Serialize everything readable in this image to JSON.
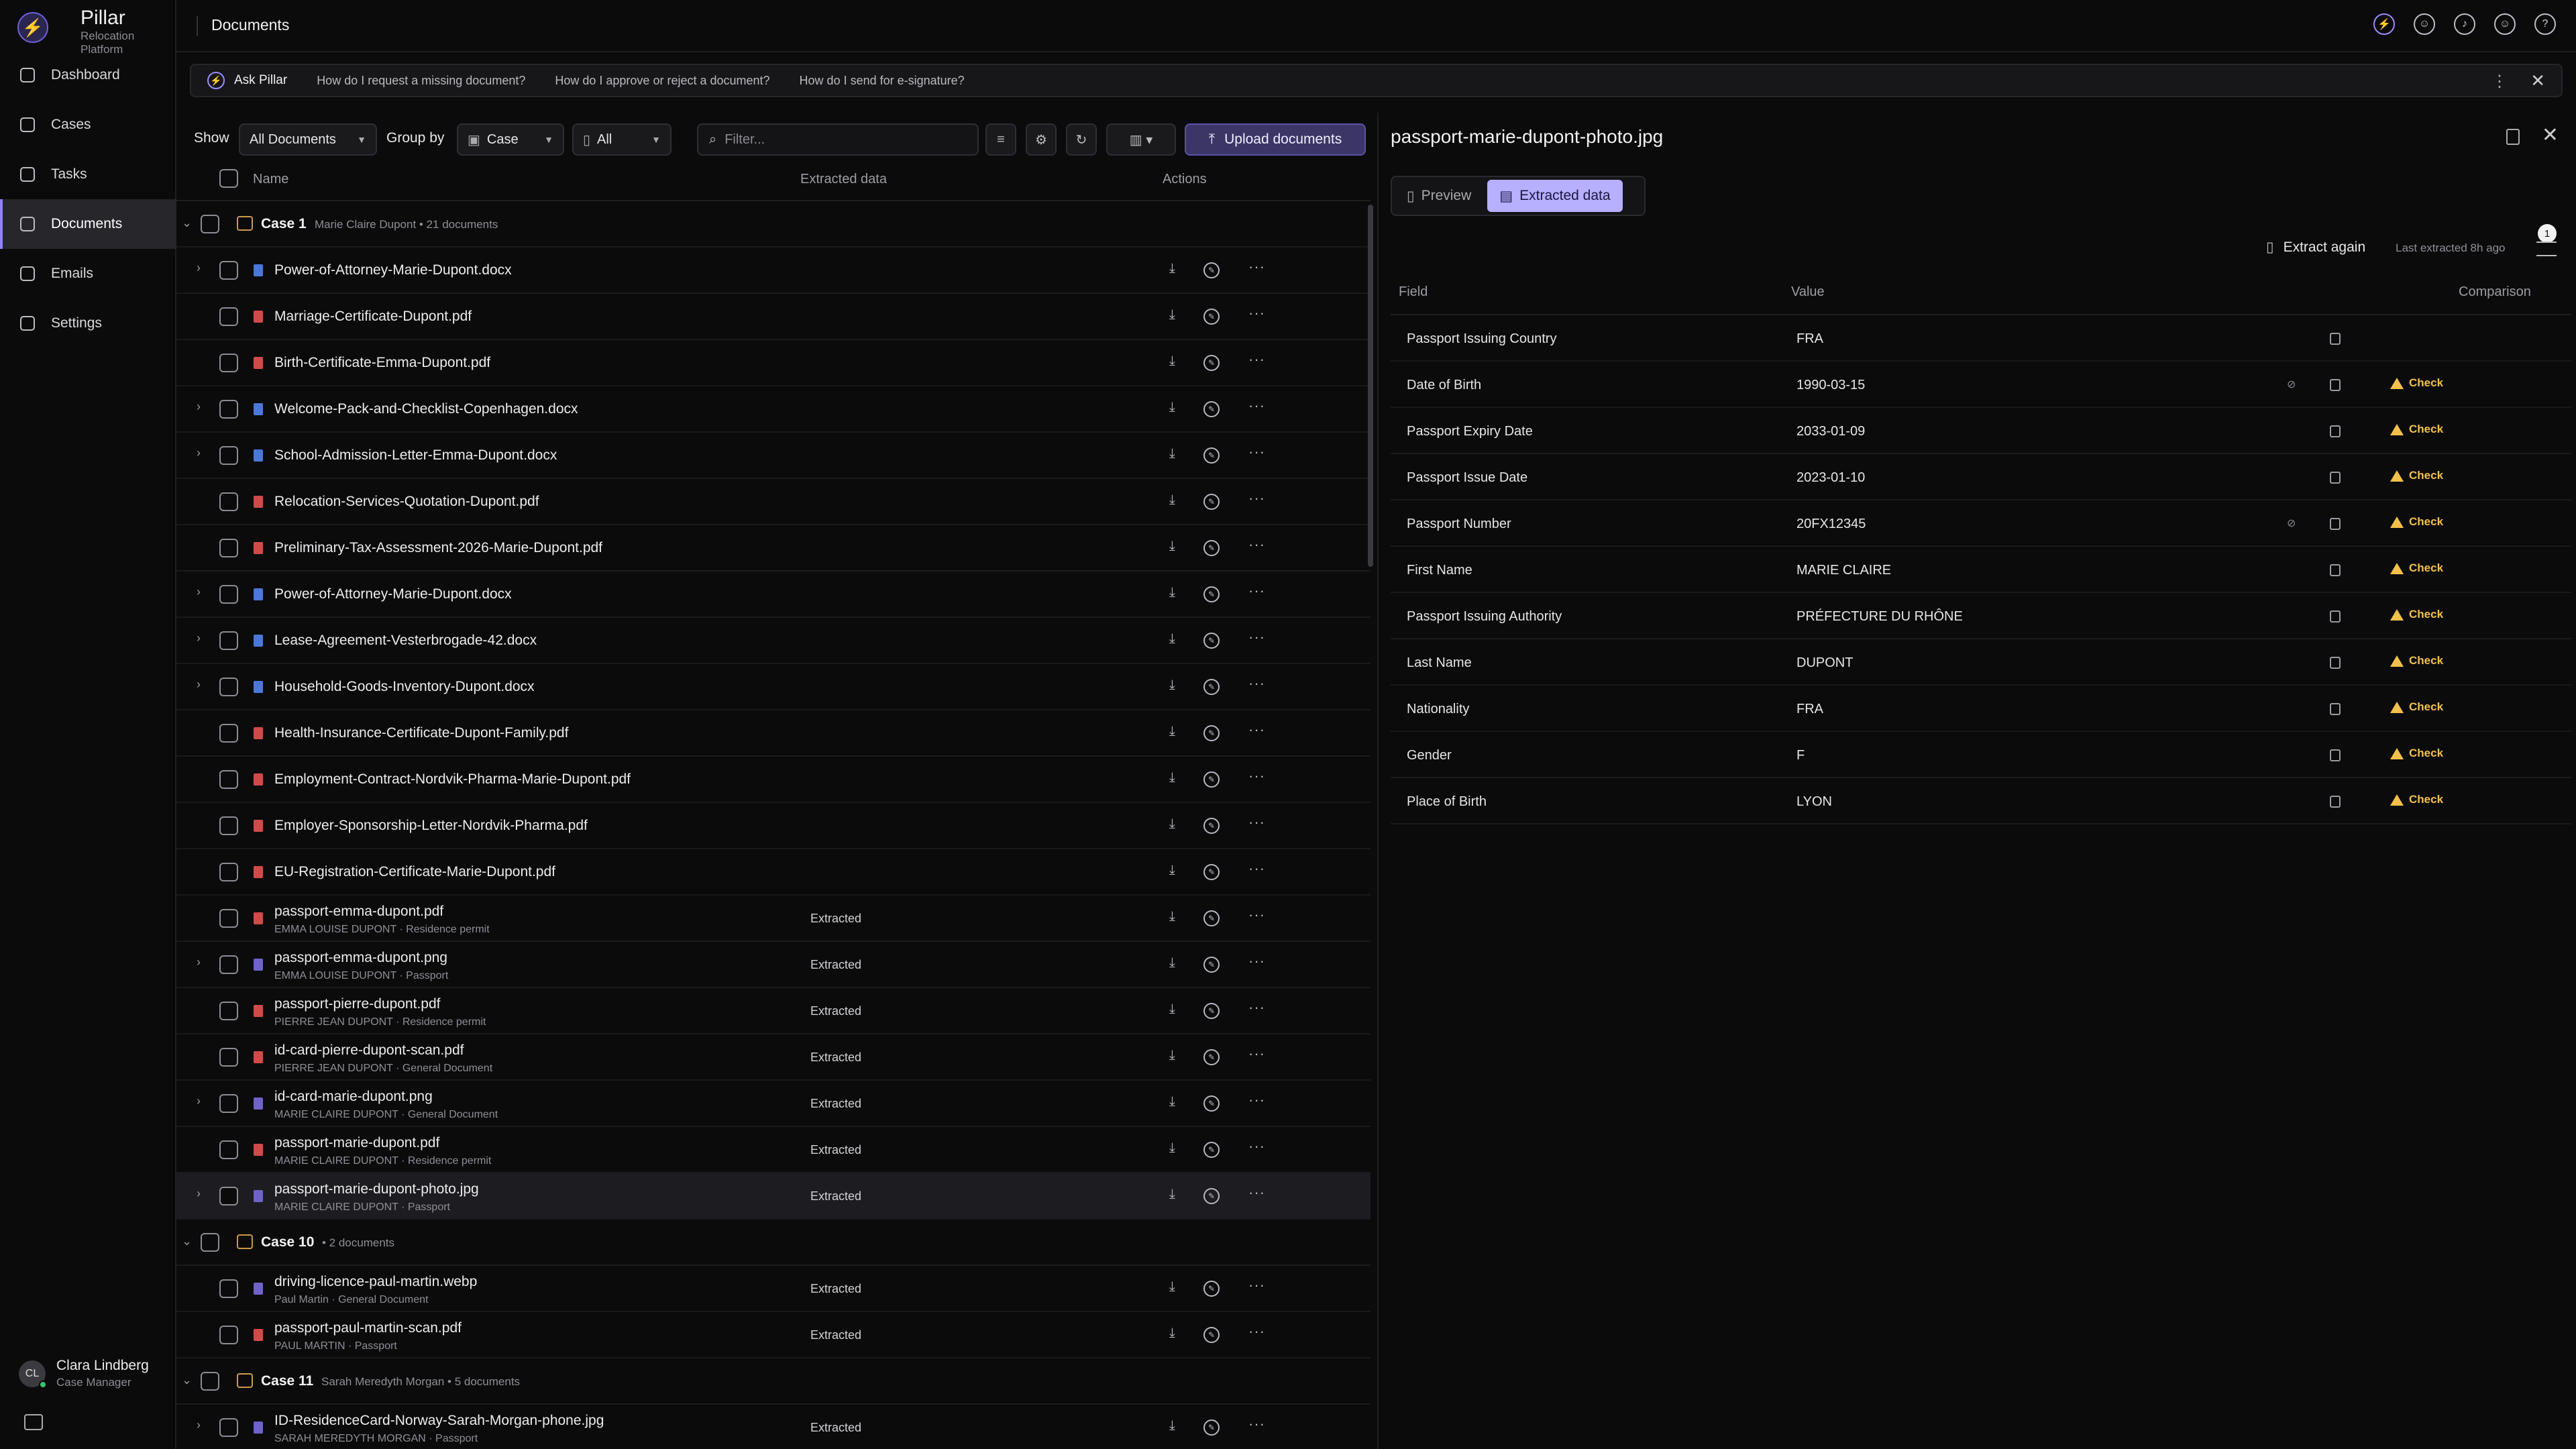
{
  "sidebar": {
    "brand": "Pillar",
    "brand_sub": "Relocation Platform",
    "nav": [
      "Dashboard",
      "Cases",
      "Tasks",
      "Documents",
      "Emails",
      "Settings"
    ],
    "active": "Documents",
    "user": {
      "initials": "CL",
      "name": "Clara Lindberg",
      "role": "Case Manager"
    }
  },
  "topbar": {
    "title": "Documents"
  },
  "ask": {
    "label": "Ask Pillar",
    "questions": [
      "How do I request a missing document?",
      "How do I approve or reject a document?",
      "How do I send for e-signature?"
    ]
  },
  "toolbar": {
    "show_label": "Show",
    "show_value": "All Documents",
    "group_label": "Group by",
    "group_value": "Case",
    "type_value": "All",
    "filter_placeholder": "Filter...",
    "upload_label": "Upload documents"
  },
  "table": {
    "headers": {
      "name": "Name",
      "extracted": "Extracted data",
      "actions": "Actions"
    },
    "groups": [
      {
        "name": "Case 1",
        "meta": "Marie Claire Dupont • 21 documents",
        "rows": [
          {
            "name": "Power-of-Attorney-Marie-Dupont.docx",
            "type": "docx",
            "expandable": true,
            "sub": "",
            "status": ""
          },
          {
            "name": "Marriage-Certificate-Dupont.pdf",
            "type": "pdf",
            "expandable": false,
            "sub": "",
            "status": ""
          },
          {
            "name": "Birth-Certificate-Emma-Dupont.pdf",
            "type": "pdf",
            "expandable": false,
            "sub": "",
            "status": ""
          },
          {
            "name": "Welcome-Pack-and-Checklist-Copenhagen.docx",
            "type": "docx",
            "expandable": true,
            "sub": "",
            "status": ""
          },
          {
            "name": "School-Admission-Letter-Emma-Dupont.docx",
            "type": "docx",
            "expandable": true,
            "sub": "",
            "status": ""
          },
          {
            "name": "Relocation-Services-Quotation-Dupont.pdf",
            "type": "pdf",
            "expandable": false,
            "sub": "",
            "status": ""
          },
          {
            "name": "Preliminary-Tax-Assessment-2026-Marie-Dupont.pdf",
            "type": "pdf",
            "expandable": false,
            "sub": "",
            "status": ""
          },
          {
            "name": "Power-of-Attorney-Marie-Dupont.docx",
            "type": "docx",
            "expandable": true,
            "sub": "",
            "status": ""
          },
          {
            "name": "Lease-Agreement-Vesterbrogade-42.docx",
            "type": "docx",
            "expandable": true,
            "sub": "",
            "status": ""
          },
          {
            "name": "Household-Goods-Inventory-Dupont.docx",
            "type": "docx",
            "expandable": true,
            "sub": "",
            "status": ""
          },
          {
            "name": "Health-Insurance-Certificate-Dupont-Family.pdf",
            "type": "pdf",
            "expandable": false,
            "sub": "",
            "status": ""
          },
          {
            "name": "Employment-Contract-Nordvik-Pharma-Marie-Dupont.pdf",
            "type": "pdf",
            "expandable": false,
            "sub": "",
            "status": ""
          },
          {
            "name": "Employer-Sponsorship-Letter-Nordvik-Pharma.pdf",
            "type": "pdf",
            "expandable": false,
            "sub": "",
            "status": ""
          },
          {
            "name": "EU-Registration-Certificate-Marie-Dupont.pdf",
            "type": "pdf",
            "expandable": false,
            "sub": "",
            "status": ""
          },
          {
            "name": "passport-emma-dupont.pdf",
            "type": "pdf",
            "expandable": false,
            "sub": "EMMA LOUISE DUPONT · Residence permit",
            "status": "Extracted"
          },
          {
            "name": "passport-emma-dupont.png",
            "type": "img",
            "expandable": true,
            "sub": "EMMA LOUISE DUPONT · Passport",
            "status": "Extracted"
          },
          {
            "name": "passport-pierre-dupont.pdf",
            "type": "pdf",
            "expandable": false,
            "sub": "PIERRE JEAN DUPONT · Residence permit",
            "status": "Extracted"
          },
          {
            "name": "id-card-pierre-dupont-scan.pdf",
            "type": "pdf",
            "expandable": false,
            "sub": "PIERRE JEAN DUPONT · General Document",
            "status": "Extracted"
          },
          {
            "name": "id-card-marie-dupont.png",
            "type": "img",
            "expandable": true,
            "sub": "MARIE CLAIRE DUPONT · General Document",
            "status": "Extracted"
          },
          {
            "name": "passport-marie-dupont.pdf",
            "type": "pdf",
            "expandable": false,
            "sub": "MARIE CLAIRE DUPONT · Residence permit",
            "status": "Extracted"
          },
          {
            "name": "passport-marie-dupont-photo.jpg",
            "type": "img",
            "expandable": true,
            "sub": "MARIE CLAIRE DUPONT · Passport",
            "status": "Extracted",
            "selected": true
          }
        ]
      },
      {
        "name": "Case 10",
        "meta": "• 2 documents",
        "rows": [
          {
            "name": "driving-licence-paul-martin.webp",
            "type": "img",
            "expandable": false,
            "sub": "Paul Martin · General Document",
            "status": "Extracted"
          },
          {
            "name": "passport-paul-martin-scan.pdf",
            "type": "pdf",
            "expandable": false,
            "sub": "PAUL MARTIN · Passport",
            "status": "Extracted"
          }
        ]
      },
      {
        "name": "Case 11",
        "meta": "Sarah Meredyth Morgan • 5 documents",
        "rows": [
          {
            "name": "ID-ResidenceCard-Norway-Sarah-Morgan-phone.jpg",
            "type": "img",
            "expandable": true,
            "sub": "SARAH MEREDYTH MORGAN · Passport",
            "status": "Extracted"
          }
        ]
      }
    ]
  },
  "panel": {
    "title": "passport-marie-dupont-photo.jpg",
    "tabs": [
      "Preview",
      "Extracted data"
    ],
    "active_tab": "Extracted data",
    "extract_again": "Extract again",
    "last_extracted": "Last extracted 8h ago",
    "badge": "1",
    "headers": {
      "field": "Field",
      "value": "Value",
      "comparison": "Comparison"
    },
    "check_label": "Check",
    "fields": [
      {
        "field": "Passport Issuing Country",
        "value": "FRA",
        "hidden_icon": false,
        "check": false
      },
      {
        "field": "Date of Birth",
        "value": "1990-03-15",
        "hidden_icon": true,
        "check": true
      },
      {
        "field": "Passport Expiry Date",
        "value": "2033-01-09",
        "hidden_icon": false,
        "check": true
      },
      {
        "field": "Passport Issue Date",
        "value": "2023-01-10",
        "hidden_icon": false,
        "check": true
      },
      {
        "field": "Passport Number",
        "value": "20FX12345",
        "hidden_icon": true,
        "check": true
      },
      {
        "field": "First Name",
        "value": "MARIE CLAIRE",
        "hidden_icon": false,
        "check": true
      },
      {
        "field": "Passport Issuing Authority",
        "value": "PRÉFECTURE DU RHÔNE",
        "hidden_icon": false,
        "check": true
      },
      {
        "field": "Last Name",
        "value": "DUPONT",
        "hidden_icon": false,
        "check": true
      },
      {
        "field": "Nationality",
        "value": "FRA",
        "hidden_icon": false,
        "check": true
      },
      {
        "field": "Gender",
        "value": "F",
        "hidden_icon": false,
        "check": true
      },
      {
        "field": "Place of Birth",
        "value": "LYON",
        "hidden_icon": false,
        "check": true
      }
    ]
  }
}
